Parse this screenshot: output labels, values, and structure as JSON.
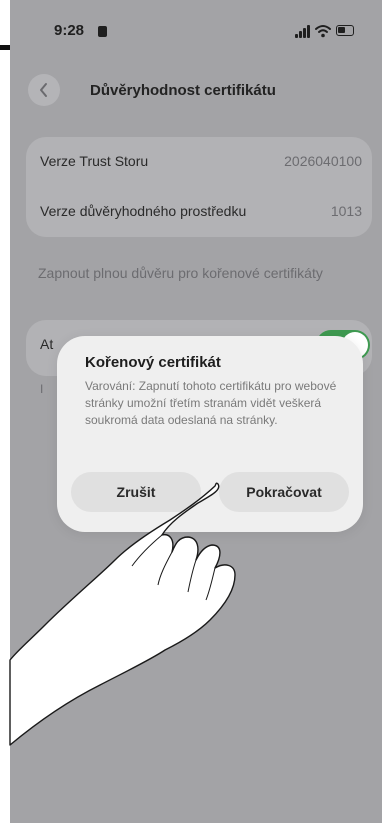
{
  "status_bar": {
    "time": "9:28",
    "icons": [
      "signal-icon",
      "wifi-icon",
      "battery-icon"
    ]
  },
  "nav": {
    "back_icon": "chevron-left-icon",
    "title": "Důvěryhodnost certifikátu"
  },
  "info": {
    "rows": [
      {
        "label": "Verze Trust Storu",
        "value": "2026040100"
      },
      {
        "label": "Verze důvěryhodného prostředku",
        "value": "1013"
      }
    ]
  },
  "section": {
    "label": "Zapnout plnou důvěru pro kořenové certifikáty"
  },
  "toggle_row": {
    "label": "At",
    "footnote": "I",
    "enabled": true,
    "accent": "#3e9950"
  },
  "dialog": {
    "title": "Kořenový certifikát",
    "message": "Varování: Zapnutí tohoto certifikátu pro webové stránky umožní třetím stranám vidět veškerá soukromá data odeslaná na stránky.",
    "cancel_label": "Zrušit",
    "continue_label": "Pokračovat"
  }
}
